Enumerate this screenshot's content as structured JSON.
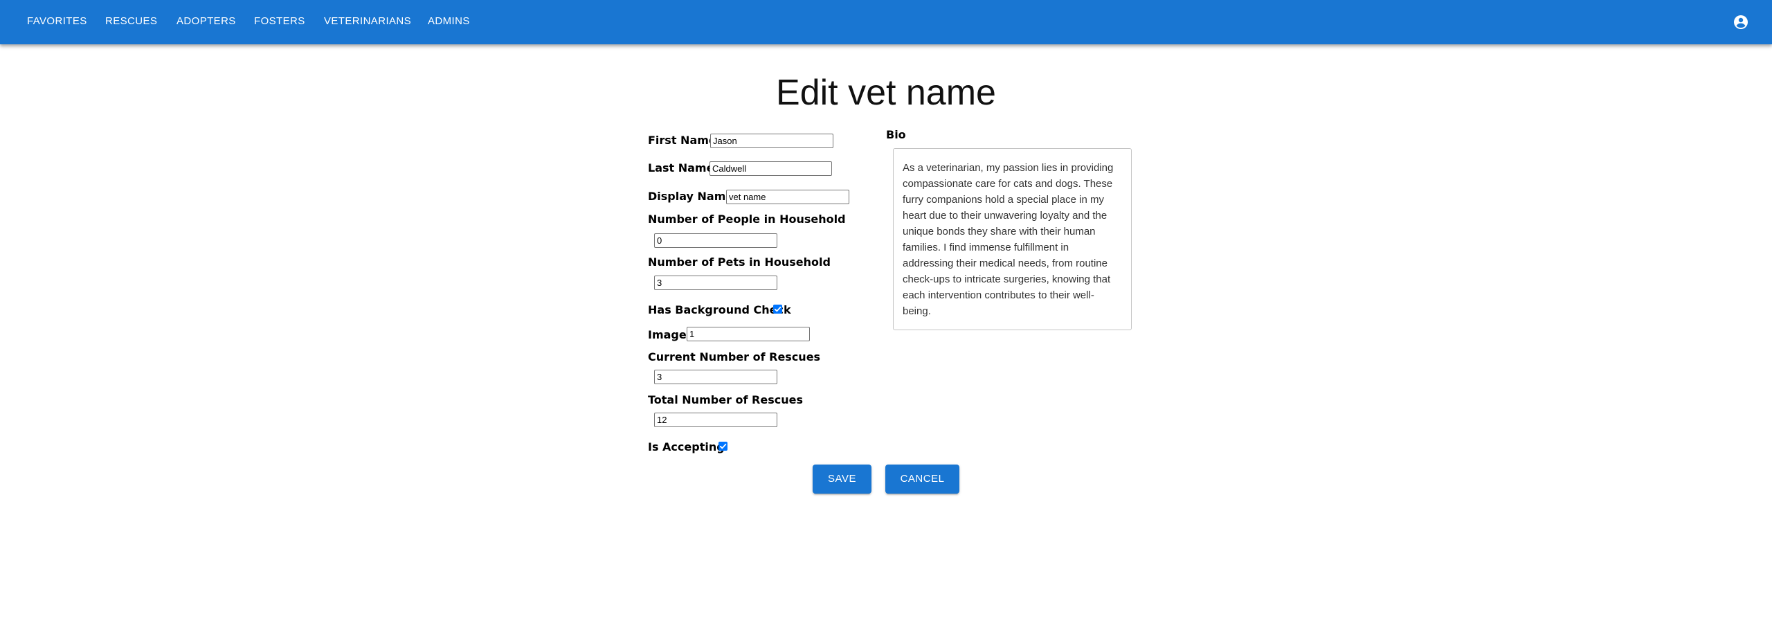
{
  "nav": {
    "items": [
      {
        "label": "FAVORITES"
      },
      {
        "label": "RESCUES"
      },
      {
        "label": "ADOPTERS"
      },
      {
        "label": "FOSTERS"
      },
      {
        "label": "VETERINARIANS"
      },
      {
        "label": "ADMINS"
      }
    ],
    "account_icon": "account-circle-icon"
  },
  "page": {
    "title": "Edit vet name"
  },
  "form": {
    "first_name": {
      "label": "First Name",
      "value": "Jason"
    },
    "last_name": {
      "label": "Last Name",
      "value": "Caldwell"
    },
    "display_name": {
      "label": "Display Name",
      "value": "vet name"
    },
    "people_in_household": {
      "label": "Number of People in Household",
      "value": "0"
    },
    "pets_in_household": {
      "label": "Number of Pets in Household",
      "value": "3"
    },
    "background_check": {
      "label": "Has Background Check",
      "checked": true
    },
    "image": {
      "label": "Image",
      "value": "1"
    },
    "current_rescues": {
      "label": "Current Number of Rescues",
      "value": "3"
    },
    "total_rescues": {
      "label": "Total Number of Rescues",
      "value": "12"
    },
    "is_accepting": {
      "label": "Is Accepting",
      "checked": true
    },
    "bio": {
      "label": "Bio",
      "value": "As a veterinarian, my passion lies in providing compassionate care for cats and dogs. These furry companions hold a special place in my heart due to their unwavering loyalty and the unique bonds they share with their human families. I find immense fulfillment in addressing their medical needs, from routine check-ups to intricate surgeries, knowing that each intervention contributes to their well-being."
    }
  },
  "actions": {
    "save_label": "SAVE",
    "cancel_label": "CANCEL"
  },
  "colors": {
    "primary": "#1976d2",
    "checkbox": "#0075ff"
  }
}
